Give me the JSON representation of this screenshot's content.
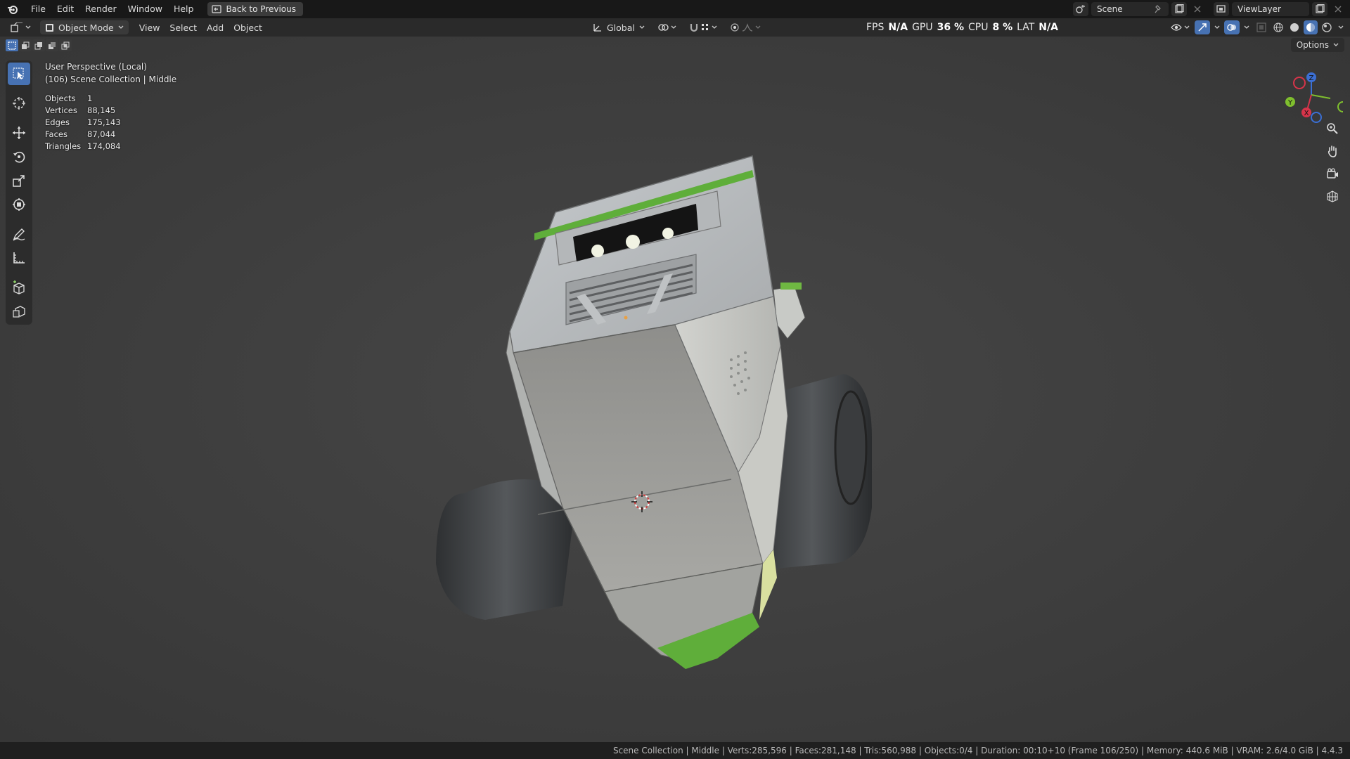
{
  "menu": {
    "items": [
      "File",
      "Edit",
      "Render",
      "Window",
      "Help"
    ],
    "back_button": "Back to Previous"
  },
  "workspace": {
    "scene_name": "Scene",
    "view_layer": "ViewLayer"
  },
  "header": {
    "mode": "Object Mode",
    "menus": [
      "View",
      "Select",
      "Add",
      "Object"
    ],
    "transform_orientation": "Global",
    "options": "Options"
  },
  "perf": {
    "fps_label": "FPS",
    "fps_value": "N/A",
    "gpu_label": "GPU",
    "gpu_value": "36 %",
    "cpu_label": "CPU",
    "cpu_value": "8 %",
    "lat_label": "LAT",
    "lat_value": "N/A"
  },
  "viewport": {
    "perspective": "User Perspective (Local)",
    "collection": "(106) Scene Collection | Middle",
    "stats": [
      {
        "label": "Objects",
        "value": "1"
      },
      {
        "label": "Vertices",
        "value": "88,145"
      },
      {
        "label": "Edges",
        "value": "175,143"
      },
      {
        "label": "Faces",
        "value": "87,044"
      },
      {
        "label": "Triangles",
        "value": "174,084"
      }
    ],
    "gizmo_labels": {
      "x": "X",
      "y": "Y",
      "z": "Z"
    }
  },
  "statusbar": {
    "text": "Scene Collection | Middle | Verts:285,596 | Faces:281,148 | Tris:560,988 | Objects:0/4 | Duration: 00:10+10 (Frame 106/250) | Memory: 440.6 MiB | VRAM: 2.6/4.0 GiB | 4.4.3"
  },
  "colors": {
    "accent": "#4772b3",
    "model_body": "#a9aaa8",
    "model_accent_green": "#5fae3a",
    "viewport_bg": "#3d3d3d"
  }
}
